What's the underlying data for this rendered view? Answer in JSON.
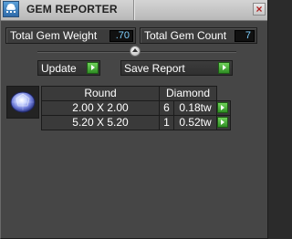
{
  "window": {
    "title": "GEM REPORTER",
    "close_icon": "close-x-icon",
    "app_icon": "gem-reporter-app-icon"
  },
  "summary": {
    "total_weight_label": "Total Gem Weight",
    "total_weight_value": ".70",
    "total_count_label": "Total Gem Count",
    "total_count_value": "7"
  },
  "actions": {
    "update_label": "Update",
    "save_report_label": "Save Report",
    "collapse_icon": "collapse-up-icon",
    "go_icon": "green-play-arrow-icon"
  },
  "gem_group": {
    "thumbnail_icon": "round-diamond-gem-icon",
    "shape_header": "Round",
    "material_header": "Diamond",
    "rows": [
      {
        "size": "2.00 X 2.00",
        "count": "6",
        "weight": "0.18tw"
      },
      {
        "size": "5.20 X 5.20",
        "count": "1",
        "weight": "0.52tw"
      }
    ]
  },
  "colors": {
    "panel_bg": "#464646",
    "field_bg": "#3c3c3c",
    "value_text": "#7fd0ff",
    "go_green": "#3aa82c",
    "title_bar": "#c8c8c8"
  }
}
